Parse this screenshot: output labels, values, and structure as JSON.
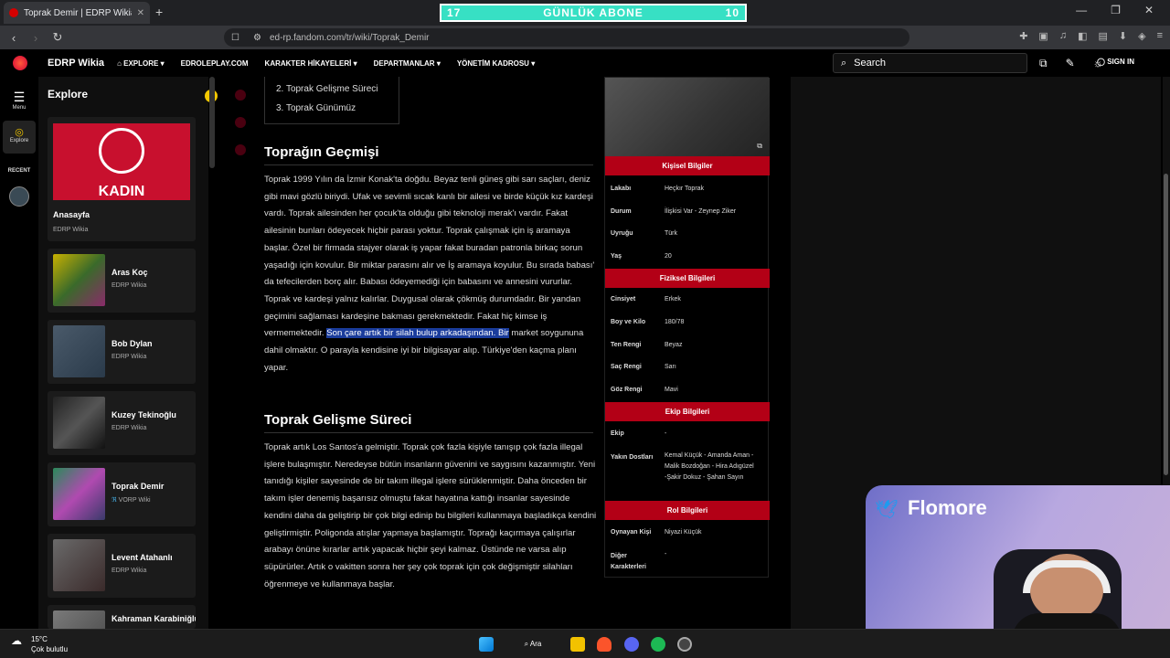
{
  "browser": {
    "tab_title": "Toprak Demir | EDRP Wikia | Fan…",
    "url": "ed-rp.fandom.com/tr/wiki/Toprak_Demir",
    "new_tab": "+",
    "window_controls": [
      "—",
      "❐",
      "✕"
    ]
  },
  "overlay": {
    "sub_left": "17",
    "sub_label": "GÜNLÜK ABONE",
    "sub_right": "10"
  },
  "site": {
    "name": "EDRP Wikia",
    "nav": [
      "EXPLORE",
      "EDROLEPLAY.COM",
      "KARAKTER HİKAYELERİ",
      "DEPARTMANLAR",
      "YÖNETİM KADROSU"
    ],
    "search_placeholder": "Search",
    "signin": "SIGN IN"
  },
  "rail": {
    "menu": "Menu",
    "explore": "Explore",
    "recent": "RECENT"
  },
  "explore": {
    "title": "Explore",
    "hero": {
      "name": "Anasayfa",
      "wiki": "EDRP Wikia",
      "banner_text": "KADIN"
    },
    "cards": [
      {
        "name": "Aras Koç",
        "wiki": "EDRP Wikia"
      },
      {
        "name": "Bob Dylan",
        "wiki": "EDRP Wikia"
      },
      {
        "name": "Kuzey Tekinoğlu",
        "wiki": "EDRP Wikia"
      },
      {
        "name": "Toprak Demir",
        "wiki": "VORP Wiki"
      },
      {
        "name": "Levent Atahanlı",
        "wiki": "EDRP Wikia"
      },
      {
        "name": "Kahraman Karabiniğlu",
        "wiki": ""
      }
    ]
  },
  "article": {
    "toc": [
      "2.  Toprak Gelişme Süreci",
      "3.  Toprak Günümüz"
    ],
    "h_past": "Toprağın Geçmişi",
    "p_past_a": "Toprak 1999 Yılın da İzmir Konak'ta doğdu. Beyaz tenli güneş gibi sarı saçları, deniz gibi mavi gözlü biriydi. Ufak ve sevimli sıcak kanlı bir ailesi ve birde küçük kız kardeşi vardı. Toprak ailesinden her çocuk'ta olduğu gibi teknoloji merak'ı vardır. Fakat ailesinin bunları ödeyecek hiçbir parası yoktur. Toprak çalışmak için iş aramaya başlar. Özel bir firmada stajyer olarak iş yapar fakat buradan patronla birkaç sorun yaşadığı için kovulur. Bir miktar parasını alır ve İş aramaya koyulur. Bu sırada babası' da tefecilerden borç alır. Babası ödeyemediği için babasını ve annesini vururlar. Toprak ve kardeşi yalnız kalırlar. Duygusal olarak çökmüş durumdadır. Bir yandan geçimini sağlaması kardeşine bakması gerekmektedir. Fakat hiç kimse iş vermemektedir. ",
    "p_past_hl": "Son çare artık bir silah bulup arkadaşından. Bir",
    "p_past_b": " market soygununa dahil olmaktır. O parayla kendisine iyi bir bilgisayar alıp. Türkiye'den kaçma planı yapar.",
    "h_dev": "Toprak Gelişme Süreci",
    "p_dev": "Toprak artık Los Santos'a gelmiştir. Toprak çok fazla kişiyle tanışıp çok fazla illegal işlere bulaşmıştır. Neredeyse bütün insanların güvenini ve saygısını kazanmıştır. Yeni tanıdığı kişiler sayesinde de bir takım illegal işlere sürüklenmiştir. Daha önceden bir takım işler denemiş başarısız olmuştu fakat hayatına kattığı insanlar sayesinde kendini daha da geliştirip bir çok bilgi edinip bu bilgileri kullanmaya başladıkça kendini geliştirmiştir. Poligonda atışlar yapmaya başlamıştır. Toprağı kaçırmaya çalışırlar arabayı önüne kırarlar artık yapacak hiçbir şeyi kalmaz. Üstünde ne varsa alıp süpürürler. Artık o vakitten sonra her şey çok toprak için çok değişmiştir silahları öğrenmeye ve kullanmaya başlar."
  },
  "infobox": {
    "sec_personal": "Kişisel Bilgiler",
    "personal": [
      {
        "k": "Lakabı",
        "v": "Heçkır Toprak"
      },
      {
        "k": "Durum",
        "v": "İlişkisi Var - Zeynep Ziker"
      },
      {
        "k": "Uyruğu",
        "v": "Türk"
      },
      {
        "k": "Yaş",
        "v": "20"
      }
    ],
    "sec_physical": "Fiziksel Bilgileri",
    "physical": [
      {
        "k": "Cinsiyet",
        "v": "Erkek"
      },
      {
        "k": "Boy ve Kilo",
        "v": "180/78"
      },
      {
        "k": "Ten Rengi",
        "v": "Beyaz"
      },
      {
        "k": "Saç Rengi",
        "v": "Sarı"
      },
      {
        "k": "Göz Rengi",
        "v": "Mavi"
      }
    ],
    "sec_team": "Ekip Bilgileri",
    "team": [
      {
        "k": "Ekip",
        "v": "-"
      },
      {
        "k": "Yakın Dostları",
        "v": "Kemal Küçük - Amanda Aman - Malik Bozdoğan - Hira Adıgüzel -Şakir Dokuz - Şahan Sayın"
      }
    ],
    "sec_role": "Rol Bilgileri",
    "role": [
      {
        "k": "Oynayan Kişi",
        "v": "Niyazi Küçük"
      },
      {
        "k": "Diğer Karakterleri",
        "v": "-"
      }
    ]
  },
  "webcam": {
    "name": "Flomore"
  },
  "taskbar": {
    "temp": "15°C",
    "weather": "Çok bulutlu",
    "search": "Ara"
  }
}
